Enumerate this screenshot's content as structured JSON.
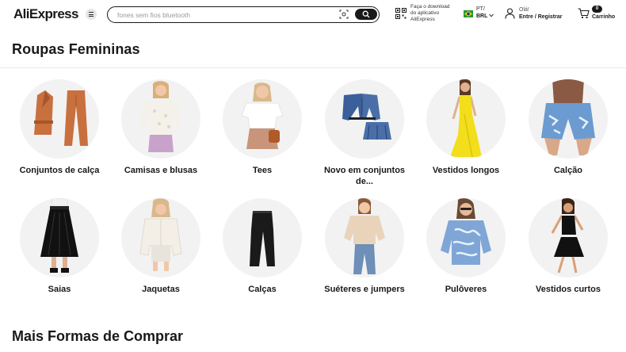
{
  "header": {
    "logo_text": "AliExpress",
    "search_placeholder": "fones sem fios bluetooth",
    "app_line1": "Faça o download",
    "app_line2": "do aplicativo",
    "app_line3": "AliExpress",
    "lang_code": "PT/",
    "currency": "BRL",
    "greeting": "Olá!",
    "signin": "Entre / Registrar",
    "cart_count": "0",
    "cart_label": "Carrinho"
  },
  "section": {
    "title": "Roupas Femininas"
  },
  "categories": [
    {
      "label": "Conjuntos de calça",
      "icon": "pants-set-image"
    },
    {
      "label": "Camisas e blusas",
      "icon": "blouse-image"
    },
    {
      "label": "Tees",
      "icon": "tee-image"
    },
    {
      "label": "Novo em conjuntos de...",
      "icon": "denim-set-image"
    },
    {
      "label": "Vestidos longos",
      "icon": "long-dress-image"
    },
    {
      "label": "Calção",
      "icon": "shorts-image"
    },
    {
      "label": "Saias",
      "icon": "skirt-image"
    },
    {
      "label": "Jaquetas",
      "icon": "jacket-image"
    },
    {
      "label": "Calças",
      "icon": "pants-image"
    },
    {
      "label": "Suéteres e jumpers",
      "icon": "sweater-image"
    },
    {
      "label": "Pulôveres",
      "icon": "pullover-image"
    },
    {
      "label": "Vestidos curtos",
      "icon": "short-dress-image"
    }
  ],
  "more": {
    "title": "Mais Formas de Comprar"
  },
  "colors": {
    "accent": "#e43225",
    "text": "#191919",
    "circle_bg": "#f2f2f2"
  }
}
